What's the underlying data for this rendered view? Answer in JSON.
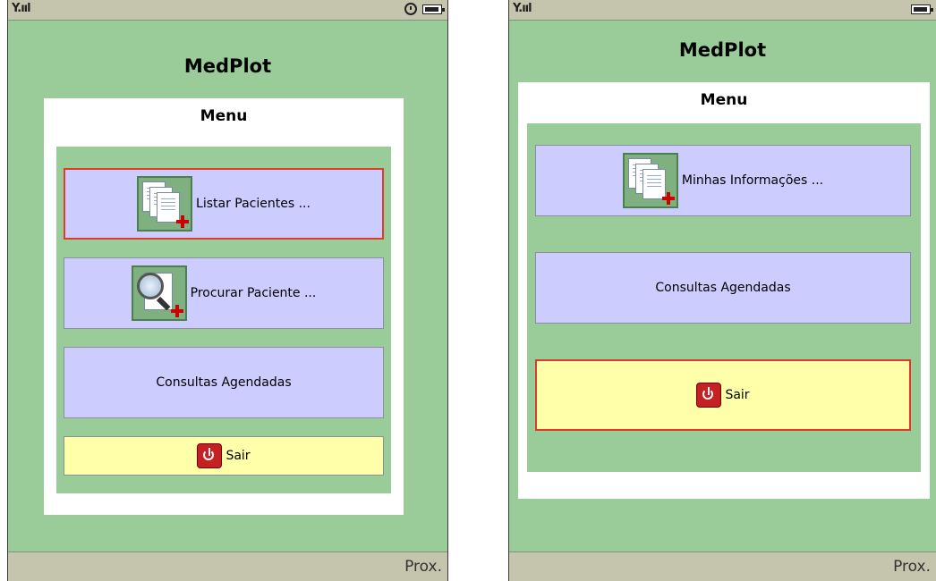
{
  "screens": [
    {
      "app_title": "MedPlot",
      "card_title": "Menu",
      "items": [
        {
          "label": "Listar Pacientes ...",
          "icon": "patient-list-icon",
          "selected": true
        },
        {
          "label": "Procurar Paciente ...",
          "icon": "search-patient-icon",
          "selected": false
        },
        {
          "label": "Consultas Agendadas",
          "icon": "",
          "selected": false
        },
        {
          "label": "Sair",
          "icon": "power-icon",
          "selected": false
        }
      ],
      "softkey": "Prox."
    },
    {
      "app_title": "MedPlot",
      "card_title": "Menu",
      "items": [
        {
          "label": "Minhas Informações ...",
          "icon": "my-info-icon",
          "selected": false
        },
        {
          "label": "Consultas Agendadas",
          "icon": "",
          "selected": false
        },
        {
          "label": "Sair",
          "icon": "power-icon",
          "selected": true
        }
      ],
      "softkey": "Prox."
    }
  ],
  "status_icons": [
    "signal-icon",
    "alarm-icon",
    "battery-icon"
  ],
  "colors": {
    "background": "#99cc99",
    "menu_item": "#ccccff",
    "exit_item": "#ffffaa",
    "selection_border": "#e03a2a",
    "bars": "#c5c5ae"
  }
}
